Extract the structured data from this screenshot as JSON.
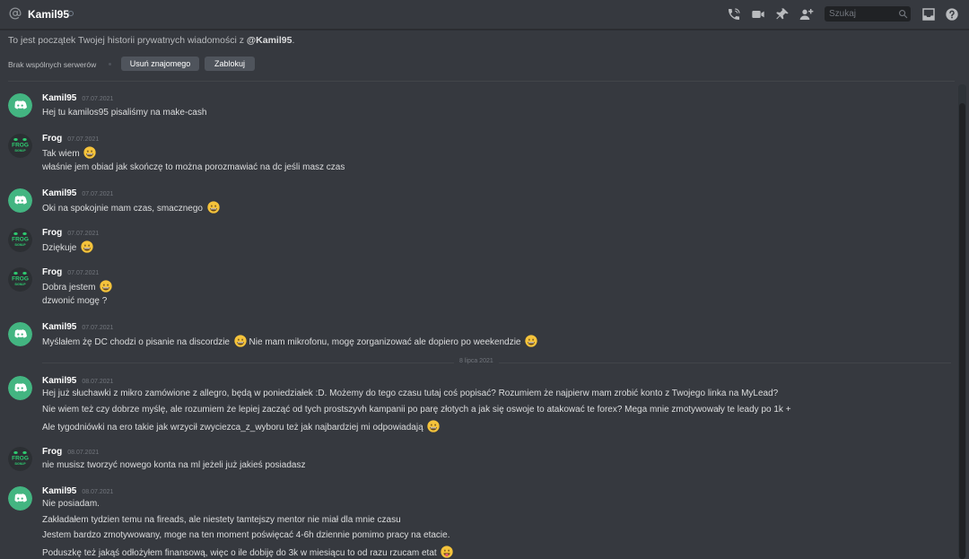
{
  "header": {
    "title": "Kamil95",
    "search_placeholder": "Szukaj"
  },
  "intro": {
    "text_prefix": "To jest początek Twojej historii prywatnych wiadomości z ",
    "username": "@Kamil95",
    "text_suffix": ".",
    "mutual_servers": "Brak wspólnych serwerów",
    "remove_friend_label": "Usuń znajomego",
    "block_label": "Zablokuj"
  },
  "date_separator": "8 lipca 2021",
  "messages": [
    {
      "author": "Kamil95",
      "timestamp": "07.07.2021",
      "lines": [
        "Hej tu kamilos95 pisaliśmy na make-cash"
      ]
    },
    {
      "author": "Frog",
      "timestamp": "07.07.2021",
      "lines": [
        "Tak wiem",
        "właśnie jem obiad jak skończę to można porozmawiać na dc jeśli masz czas"
      ]
    },
    {
      "author": "Kamil95",
      "timestamp": "07.07.2021",
      "lines": [
        "Oki na spokojnie mam czas, smacznego"
      ]
    },
    {
      "author": "Frog",
      "timestamp": "07.07.2021",
      "lines": [
        "Dziękuje"
      ]
    },
    {
      "author": "Frog",
      "timestamp": "07.07.2021",
      "lines": [
        "Dobra jestem",
        "dzwonić mogę ?"
      ]
    },
    {
      "author": "Kamil95",
      "timestamp": "07.07.2021",
      "lines": [
        "Myślałem żę DC chodzi o pisanie na discordzie",
        "Nie mam mikrofonu, mogę zorganizować ale dopiero po weekendzie"
      ]
    },
    {
      "author": "Kamil95",
      "timestamp": "08.07.2021",
      "lines": [
        "Hej już słuchawki z mikro zamówione z allegro, będą w poniedziałek :D. Możemy do tego czasu tutaj coś popisać? Rozumiem że najpierw mam zrobić konto z Twojego linka na MyLead?",
        "Nie wiem też czy dobrze myślę, ale rozumiem że lepiej zacząć od tych prostszyvh kampanii po parę złotych a jak się oswoje to atakować te forex? Mega mnie zmotywowały te leady po 1k +",
        "Ale tygodniówki na ero takie jak wrzycił zwyciezca_z_wyboru też jak najbardziej mi odpowiadają"
      ]
    },
    {
      "author": "Frog",
      "timestamp": "08.07.2021",
      "lines": [
        "nie musisz tworzyć nowego konta na ml jeżeli już jakieś posiadasz"
      ]
    },
    {
      "author": "Kamil95",
      "timestamp": "08.07.2021",
      "lines": [
        "Nie posiadam.",
        "Zakładałem tydzien temu na fireads, ale niestety tamtejszy mentor nie miał dla mnie czasu",
        "Jestem bardzo zmotywowany, moge na ten moment poświęcać 4-6h dziennie pomimo pracy na etacie.",
        "Poduszkę też jakąś odłożyłem finansową, więc o ile dobiję do 3k w miesiącu to od razu rzucam etat"
      ]
    }
  ],
  "avatar_logo_text": [
    "FROG",
    "SIGNUP"
  ],
  "colors": {
    "background": "#36393f",
    "discord_green": "#43b581",
    "frog_green": "#2ecc71"
  }
}
